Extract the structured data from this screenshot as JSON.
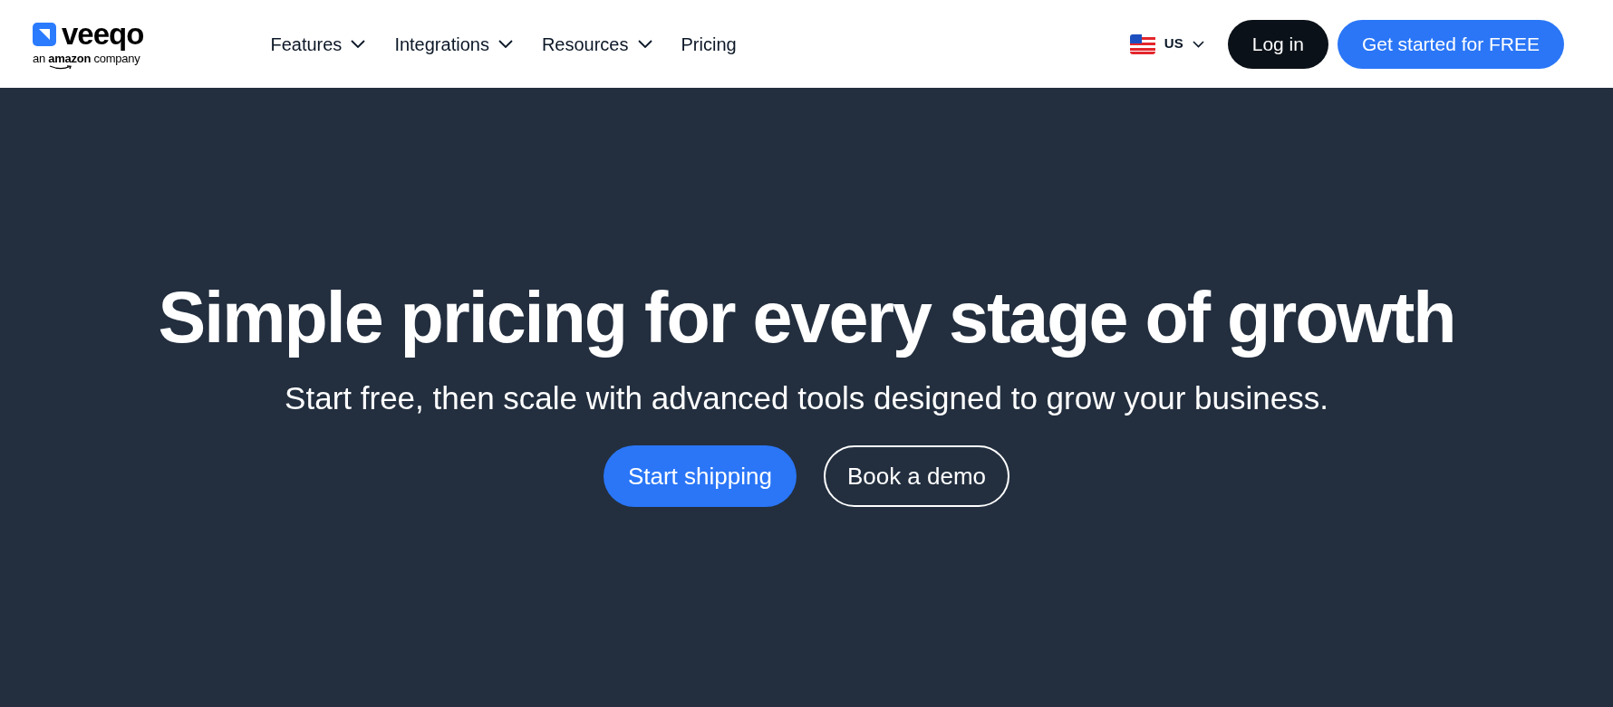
{
  "header": {
    "logo": {
      "wordmark": "veeqo",
      "tagline": "an **amazon** company"
    },
    "nav": [
      {
        "label": "Features",
        "has_dropdown": true
      },
      {
        "label": "Integrations",
        "has_dropdown": true
      },
      {
        "label": "Resources",
        "has_dropdown": true
      },
      {
        "label": "Pricing",
        "has_dropdown": false
      }
    ],
    "region": {
      "label": "US"
    },
    "buttons": [
      {
        "label": "Log in",
        "kind": "dark"
      },
      {
        "label": "Get started for FREE",
        "kind": "primary"
      }
    ]
  },
  "hero": {
    "title": "Simple pricing for every stage of growth",
    "subtitle": "Start free, then scale with advanced tools designed to grow your business.",
    "buttons": [
      {
        "label": "Start shipping",
        "kind": "primary"
      },
      {
        "label": "Book a demo",
        "kind": "outline"
      }
    ]
  }
}
